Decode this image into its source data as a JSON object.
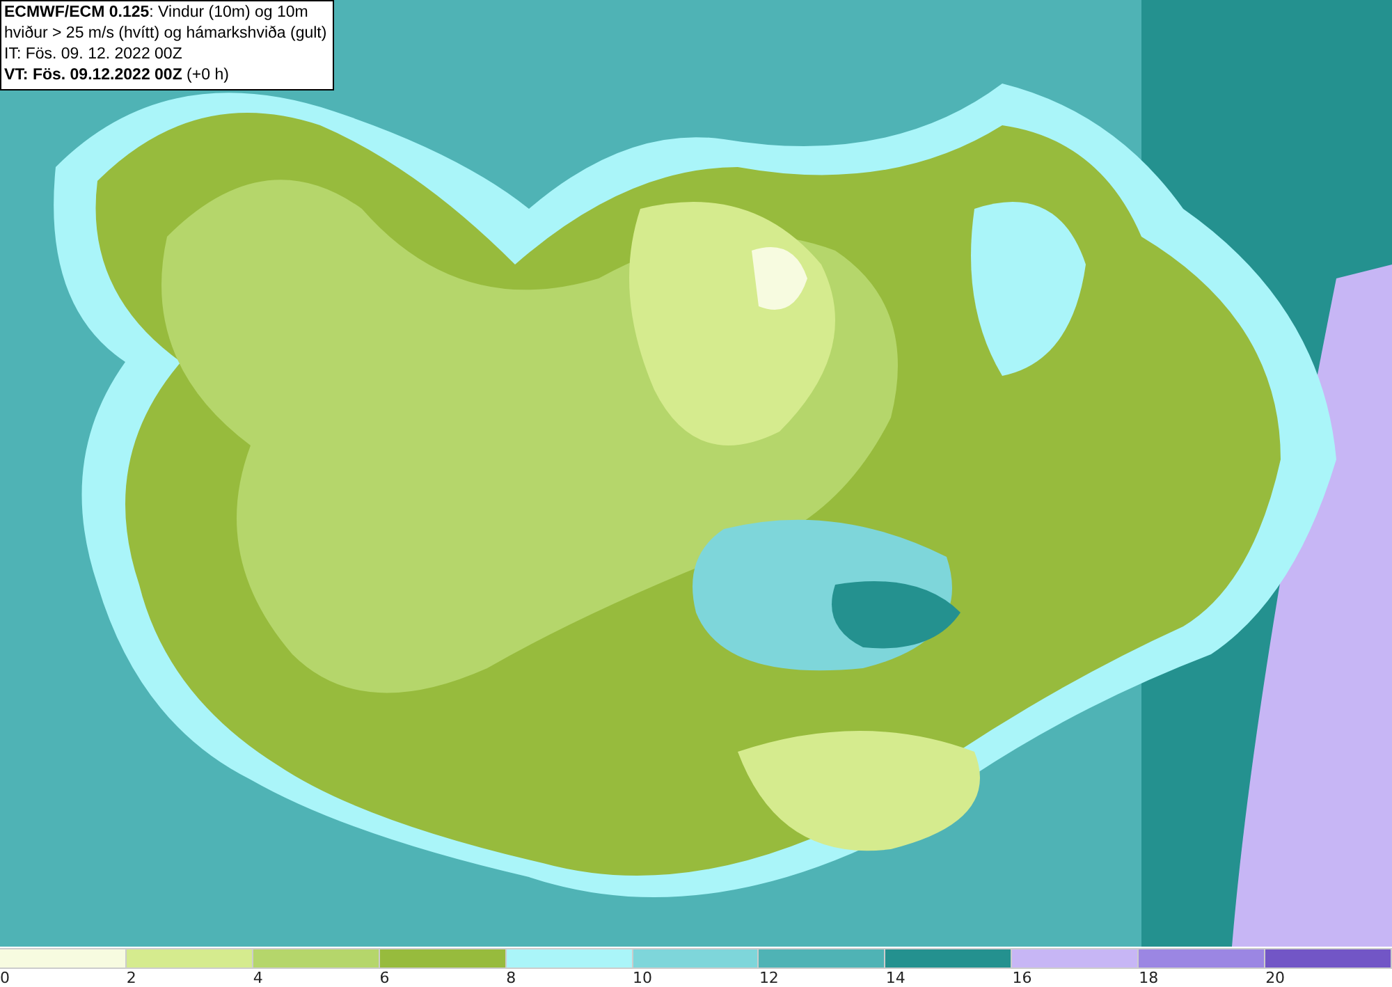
{
  "title_box": {
    "lines": [
      "**ECMWF/ECM 0.125**: Vindur (10m) og 10m",
      "hviður > 25 m/s (hvítt) og hámarkshviða (gult)",
      "IT: Fös. 09. 12. 2022 00Z",
      "**VT: Fös. 09.12.2022 00Z** (+0 h)"
    ]
  },
  "legend": [
    {
      "label": "0",
      "color": "#f7fbe0"
    },
    {
      "label": "2",
      "color": "#d5eb8e"
    },
    {
      "label": "4",
      "color": "#b5d66b"
    },
    {
      "label": "6",
      "color": "#97bb3d"
    },
    {
      "label": "8",
      "color": "#aaf5f9"
    },
    {
      "label": "10",
      "color": "#7ed6da"
    },
    {
      "label": "12",
      "color": "#4fb3b5"
    },
    {
      "label": "14",
      "color": "#24918f"
    },
    {
      "label": "16",
      "color": "#c7b6f5"
    },
    {
      "label": "18",
      "color": "#9b86e3"
    },
    {
      "label": "20",
      "color": "#7256c6"
    }
  ]
}
